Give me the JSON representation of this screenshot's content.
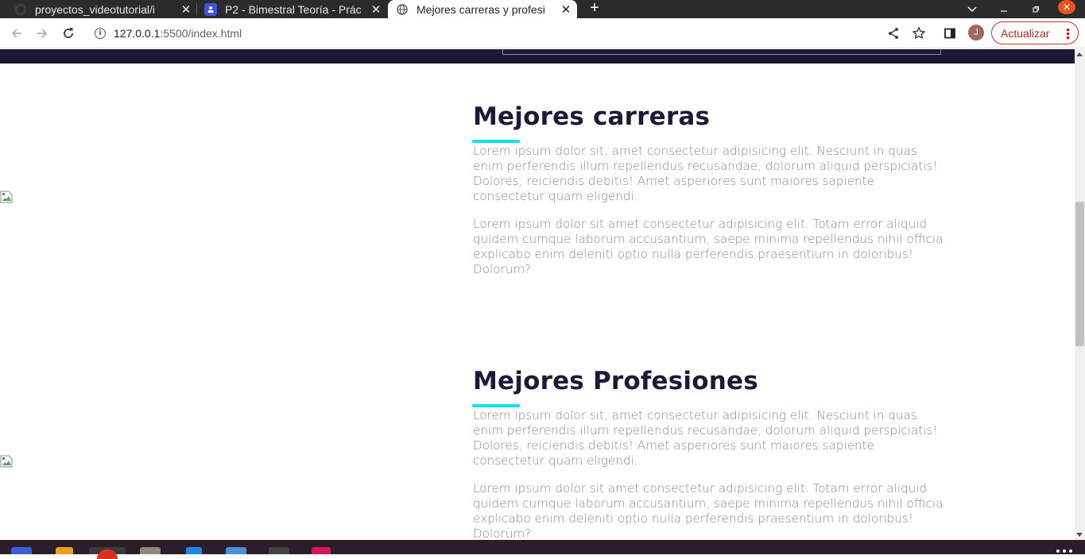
{
  "browser": {
    "tabs": [
      {
        "title": "proyectos_videotutorial/i",
        "icon": "github-icon",
        "active": false
      },
      {
        "title": "P2 - Bimestral Teoría - Prác",
        "icon": "classroom-icon",
        "active": false
      },
      {
        "title": "Mejores carreras y profesi",
        "icon": "globe-icon",
        "active": true
      }
    ],
    "new_tab_label": "+",
    "address": {
      "host": "127.0.0.1",
      "rest": ":5500/index.html"
    },
    "avatar_letter": "J",
    "update_label": "Actualizar"
  },
  "page": {
    "sections": [
      {
        "heading": "Mejores carreras",
        "paragraphs": [
          "Lorem ipsum dolor sit, amet consectetur adipisicing elit. Nesciunt in quas enim perferendis illum repellendus recusandae, dolorum aliquid perspiciatis! Dolores, reiciendis debitis! Amet asperiores sunt maiores sapiente consectetur quam eligendi.",
          "Lorem ipsum dolor sit amet consectetur adipisicing elit. Totam error aliquid quidem cumque laborum accusantium, saepe minima repellendus nihil officia explicabo enim deleniti optio nulla perferendis praesentium in doloribus! Dolorum?"
        ]
      },
      {
        "heading": "Mejores Profesiones",
        "paragraphs": [
          "Lorem ipsum dolor sit, amet consectetur adipisicing elit. Nesciunt in quas enim perferendis illum repellendus recusandae, dolorum aliquid perspiciatis! Dolores, reiciendis debitis! Amet asperiores sunt maiores sapiente consectetur quam eligendi.",
          "Lorem ipsum dolor sit amet consectetur adipisicing elit. Totam error aliquid quidem cumque laborum accusantium, saepe minima repellendus nihil officia explicabo enim deleniti optio nulla perferendis praesentium in doloribus! Dolorum?"
        ]
      }
    ]
  },
  "colors": {
    "heading": "#1c1a36",
    "accent_underline": "#00e3f3",
    "paragraph": "#8a8a8a",
    "top_band": "#1c1a36",
    "update_button": "#d93025"
  }
}
